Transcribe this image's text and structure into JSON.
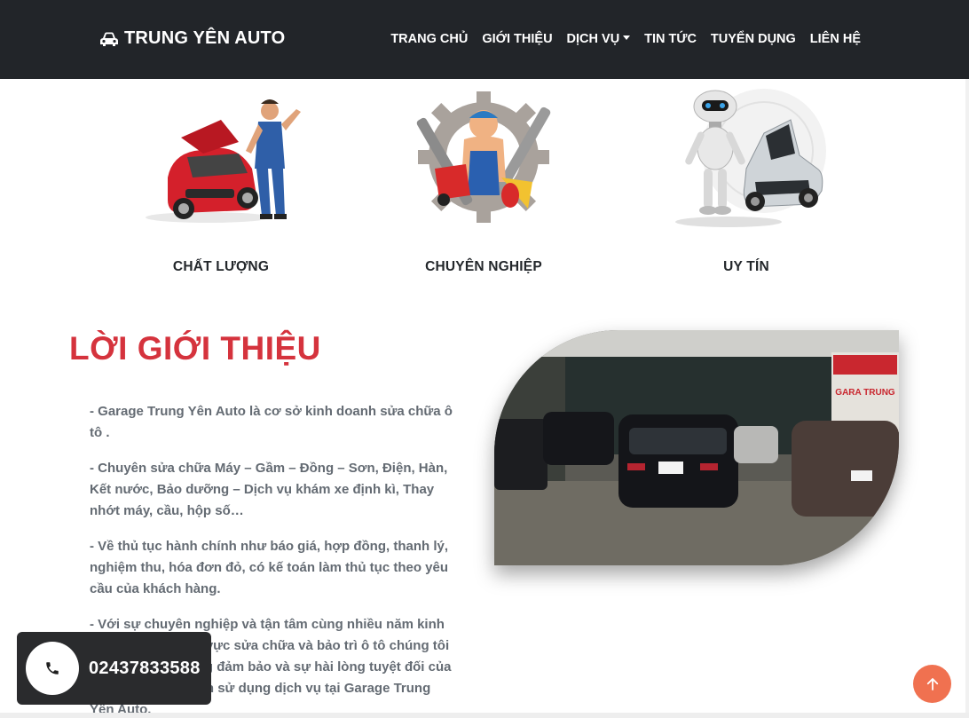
{
  "brand": {
    "name": "TRUNG YÊN AUTO",
    "icon": "car-icon"
  },
  "nav": {
    "items": [
      {
        "label": "TRANG CHỦ"
      },
      {
        "label": "GIỚI THIỆU"
      },
      {
        "label": "DỊCH VỤ",
        "dropdown": true
      },
      {
        "label": "TIN TỨC"
      },
      {
        "label": "TUYỂN DỤNG"
      },
      {
        "label": "LIÊN HỆ"
      }
    ]
  },
  "features": [
    {
      "caption": "CHẤT LƯỢNG",
      "image": "mechanic-with-red-car"
    },
    {
      "caption": "CHUYÊN NGHIỆP",
      "image": "mechanic-gear-tools"
    },
    {
      "caption": "UY TÍN",
      "image": "robot-with-silver-car"
    }
  ],
  "intro": {
    "title": "LỜI GIỚI THIỆU",
    "paragraphs": [
      "- Garage Trung Yên Auto là cơ sở kinh doanh sửa chữa ô tô .",
      "- Chuyên sửa chữa Máy – Gầm – Đồng – Sơn, Điện, Hàn, Kết nước, Bảo dưỡng – Dịch vụ khám xe định kì, Thay nhớt máy, cầu, hộp số…",
      "- Về thủ tục hành chính như báo giá, hợp đồng, thanh lý, nghiệm thu, hóa đơn đỏ, có kế toán làm thủ tục theo yêu cầu của khách hàng.",
      "- Với sự chuyên nghiệp và tận tâm cùng nhiều năm kinh nghiệm trong lĩnh vực sửa chữa và bảo trì ô tô chúng tôi cam kết chất lượng đảm bảo và sự hài lòng tuyệt đối của khách hàng khi đến sử dụng dịch vụ tại Garage Trung Yên Auto."
    ],
    "photo_sign": "GARA TRUNG"
  },
  "hotline": {
    "number": "02437833588",
    "icon": "phone-icon"
  },
  "back_to_top": {
    "icon": "arrow-up-icon"
  },
  "colors": {
    "nav_bg": "#222529",
    "title_red": "#d5333d",
    "accent_orange": "#f07150",
    "text_gray": "#646b73"
  }
}
